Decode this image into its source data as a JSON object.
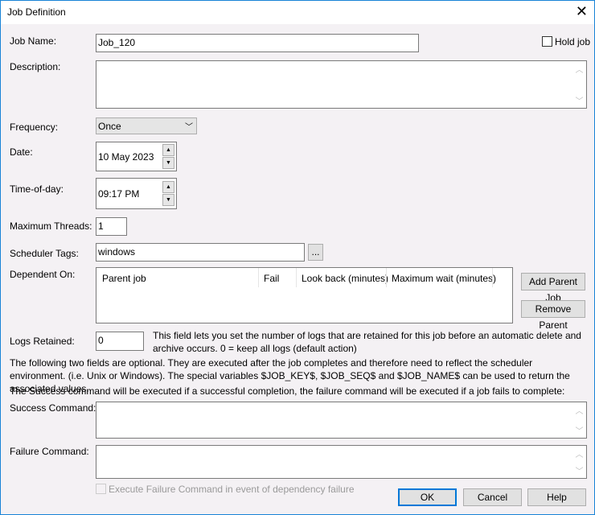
{
  "title": "Job Definition",
  "job_name": {
    "label": "Job Name:",
    "value": "Job_120"
  },
  "hold_job": {
    "label": "Hold job",
    "checked": false
  },
  "description": {
    "label": "Description:",
    "value": ""
  },
  "frequency": {
    "label": "Frequency:",
    "value": "Once"
  },
  "date": {
    "label": "Date:",
    "value": "10 May 2023"
  },
  "time": {
    "label": "Time-of-day:",
    "value": "09:17 PM"
  },
  "max_threads": {
    "label": "Maximum Threads:",
    "value": "1"
  },
  "tags": {
    "label": "Scheduler Tags:",
    "value": "windows",
    "browse": "..."
  },
  "dependent": {
    "label": "Dependent On:",
    "columns": [
      "Parent job",
      "Fail",
      "Look back (minutes)",
      "Maximum wait (minutes)"
    ],
    "add": "Add Parent Job",
    "remove": "Remove Parent"
  },
  "logs": {
    "label": "Logs Retained:",
    "value": "0",
    "help": "This field lets you set the number of logs that are retained for this job before an automatic delete and archive occurs. 0 = keep all logs (default action)"
  },
  "info1": "The following two fields are optional. They are executed after the job completes and therefore need to reflect the scheduler environment. (i.e. Unix or Windows). The special variables $JOB_KEY$, $JOB_SEQ$ and $JOB_NAME$ can be used to return the associated values.",
  "info2": "The Success command will be executed if a successful completion, the failure command will be executed if a job fails to complete:",
  "success": {
    "label": "Success Command:",
    "value": ""
  },
  "failure": {
    "label": "Failure Command:",
    "value": ""
  },
  "exec_fail": {
    "label": "Execute Failure Command in event of dependency failure",
    "checked": false
  },
  "buttons": {
    "ok": "OK",
    "cancel": "Cancel",
    "help": "Help"
  }
}
